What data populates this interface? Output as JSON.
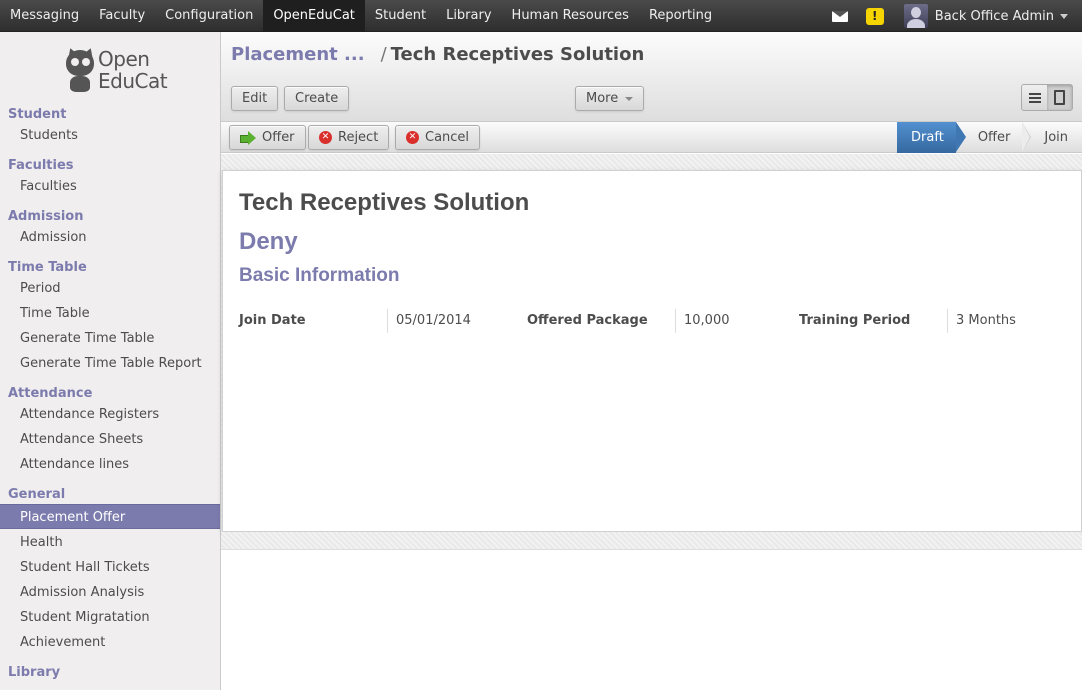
{
  "topbar": {
    "menu": [
      "Messaging",
      "Faculty",
      "Configuration",
      "OpenEduCat",
      "Student",
      "Library",
      "Human Resources",
      "Reporting"
    ],
    "active_menu": "OpenEduCat",
    "user_name": "Back Office Admin",
    "icons": [
      "mail-icon",
      "warning-icon",
      "avatar"
    ]
  },
  "logo": {
    "line1": "Open",
    "line2": "EduCat"
  },
  "sidebar": {
    "sections": [
      {
        "title": "Student",
        "items": [
          "Students"
        ]
      },
      {
        "title": "Faculties",
        "items": [
          "Faculties"
        ]
      },
      {
        "title": "Admission",
        "items": [
          "Admission"
        ]
      },
      {
        "title": "Time Table",
        "items": [
          "Period",
          "Time Table",
          "Generate Time Table",
          "Generate Time Table Report"
        ]
      },
      {
        "title": "Attendance",
        "items": [
          "Attendance Registers",
          "Attendance Sheets",
          "Attendance lines"
        ]
      },
      {
        "title": "General",
        "items": [
          "Placement Offer",
          "Health",
          "Student Hall Tickets",
          "Admission Analysis",
          "Student Migratation",
          "Achievement"
        ]
      },
      {
        "title": "Library",
        "items": []
      }
    ],
    "active_item": "Placement Offer"
  },
  "breadcrumb": {
    "parent": "Placement ...",
    "separator": "/",
    "current": "Tech Receptives Solution"
  },
  "toolbar": {
    "edit_label": "Edit",
    "create_label": "Create",
    "more_label": "More"
  },
  "statusbar": {
    "offer_label": "Offer",
    "reject_label": "Reject",
    "cancel_label": "Cancel",
    "stages": [
      "Draft",
      "Offer",
      "Join"
    ],
    "current_stage": "Draft"
  },
  "record": {
    "name": "Tech Receptives Solution",
    "status_heading": "Deny",
    "section_title": "Basic Information",
    "fields": [
      {
        "label": "Join Date",
        "value": "05/01/2014"
      },
      {
        "label": "Offered Package",
        "value": "10,000"
      },
      {
        "label": "Training Period",
        "value": "3 Months"
      }
    ]
  },
  "colors": {
    "accent": "#7c7bad",
    "topbar": "#414141",
    "stage_active": "#3f79b9"
  }
}
